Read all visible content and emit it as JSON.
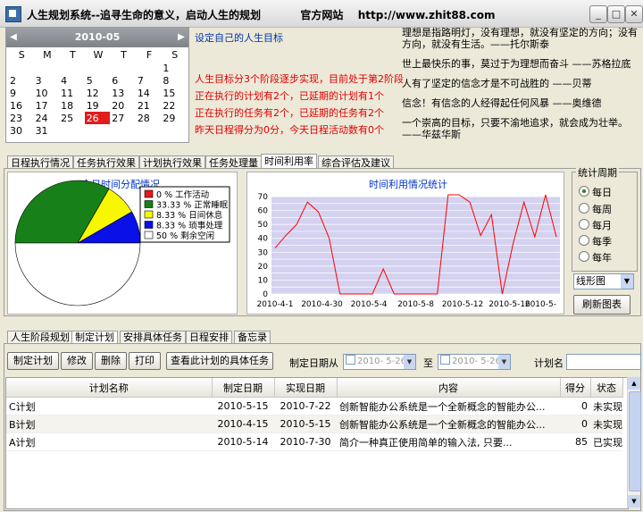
{
  "window": {
    "title": "人生规划系统--追寻生命的意义，启动人生的规划",
    "website_label": "官方网站",
    "website_url": "http://www.zhit88.com"
  },
  "calendar": {
    "month_title": "2010-05",
    "weekdays": [
      "S",
      "M",
      "T",
      "W",
      "T",
      "F",
      "S"
    ],
    "weeks": [
      [
        "",
        "",
        "",
        "",
        "",
        "",
        "1"
      ],
      [
        "2",
        "3",
        "4",
        "5",
        "6",
        "7",
        "8"
      ],
      [
        "9",
        "10",
        "11",
        "12",
        "13",
        "14",
        "15"
      ],
      [
        "16",
        "17",
        "18",
        "19",
        "20",
        "21",
        "22"
      ],
      [
        "23",
        "24",
        "25",
        "26",
        "27",
        "28",
        "29"
      ],
      [
        "30",
        "31",
        "",
        "",
        "",
        "",
        ""
      ]
    ],
    "selected_day": "26"
  },
  "goals": {
    "heading": "设定自己的人生目标",
    "line1": "人生目标分3个阶段逐步实现，目前处于第2阶段",
    "line2": "正在执行的计划有2个，已延期的计划有1个",
    "line3": "正在执行的任务有2个，已延期的任务有2个",
    "line4": "昨天日程得分为0分，今天日程活动数有0个"
  },
  "quotes": [
    "理想是指路明灯，没有理想，就没有坚定的方向；没有方向，就没有生活。——托尔斯泰",
    "世上最快乐的事，莫过于为理想而奋斗 ——苏格拉底",
    "人有了坚定的信念才是不可战胜的 ——贝蒂",
    "信念！有信念的人经得起任何风暴 ——奥维德",
    "一个崇高的目标，只要不渝地追求，就会成为壮举。——华兹华斯"
  ],
  "top_tabs": [
    "日程执行情况",
    "任务执行效果",
    "计划执行效果",
    "任务处理量",
    "时间利用率",
    "综合评估及建议"
  ],
  "top_tabs_active": 4,
  "pie_chart": {
    "title": "今日时间分配情况",
    "legend": [
      {
        "label": "0 % 工作活动",
        "color": "#e8171b",
        "value": 0
      },
      {
        "label": "33.33 % 正常睡眠",
        "color": "#188018",
        "value": 33.33
      },
      {
        "label": "8.33 % 日间休息",
        "color": "#f7f700",
        "value": 8.33
      },
      {
        "label": "8.33 % 琐事处理",
        "color": "#0a10e8",
        "value": 8.33
      },
      {
        "label": "50 % 剩余空闲",
        "color": "#ffffff",
        "value": 50
      }
    ]
  },
  "chart_data": {
    "type": "line",
    "title": "时间利用情况统计",
    "x_tick_labels": [
      "2010-4-1",
      "2010-4-30",
      "2010-5-4",
      "2010-5-8",
      "2010-5-12",
      "2010-5-16",
      "2010-5-"
    ],
    "ylim": [
      0,
      70
    ],
    "y_ticks": [
      0,
      5,
      10,
      15,
      20,
      25,
      30,
      35,
      40,
      45,
      50,
      55,
      60,
      65,
      70
    ],
    "series": [
      {
        "values": [
          33,
          42,
          50,
          66,
          59,
          40,
          0,
          0,
          0,
          0,
          18,
          0,
          0,
          0,
          0,
          0,
          75,
          75,
          66,
          42,
          57,
          0,
          36,
          66,
          41,
          75,
          41
        ],
        "color": "#ff0000"
      }
    ]
  },
  "period": {
    "legend": "统计周期",
    "options": [
      "每日",
      "每周",
      "每月",
      "每季",
      "每年"
    ],
    "selected": 0,
    "chart_type": "线形图",
    "refresh_label": "刷新图表"
  },
  "bottom_tabs": [
    "人生阶段规划",
    "制定计划",
    "安排具体任务",
    "日程安排",
    "备忘录"
  ],
  "bottom_tabs_active": 1,
  "toolbar": {
    "make_plan": "制定计划",
    "edit": "修改",
    "delete": "删除",
    "print": "打印",
    "view_tasks": "查看此计划的具体任务",
    "date_from_label": "制定日期从",
    "date_from": "2010- 5-26",
    "to_label": "至",
    "date_to": "2010- 5-26",
    "plan_name_label": "计划名"
  },
  "table": {
    "columns": [
      "计划名称",
      "制定日期",
      "实现日期",
      "内容",
      "得分",
      "状态"
    ],
    "rows": [
      [
        "C计划",
        "2010-5-15",
        "2010-7-22",
        "创新智能办公系统是一个全新概念的智能办公...",
        "0",
        "未实现"
      ],
      [
        "B计划",
        "2010-4-15",
        "2010-5-15",
        "创新智能办公系统是一个全新概念的智能办公...",
        "0",
        "未实现"
      ],
      [
        "A计划",
        "2010-5-14",
        "2010-7-30",
        "简介一种真正使用简单的输入法, 只要...",
        "85",
        "已实现"
      ]
    ]
  }
}
